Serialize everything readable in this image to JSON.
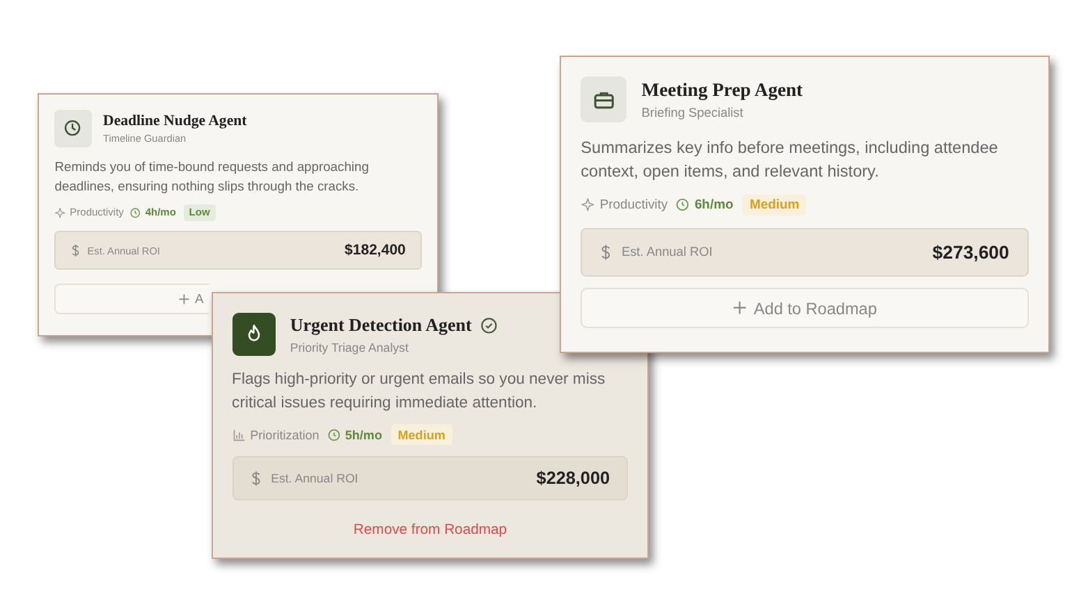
{
  "cards": [
    {
      "title": "Deadline Nudge Agent",
      "subtitle": "Timeline Guardian",
      "verified": false,
      "added": false,
      "description": "Reminds you of time-bound requests and approaching deadlines, ensuring nothing slips through the cracks.",
      "category": "Productivity",
      "time": "4h/mo",
      "tag": {
        "label": "Low",
        "color": "#5e8a3a"
      },
      "roi_label": "Est. Annual ROI",
      "roi_value": "$182,400",
      "action": "A"
    },
    {
      "title": "Urgent Detection Agent",
      "subtitle": "Priority Triage Analyst",
      "verified": true,
      "added": true,
      "description": "Flags high-priority or urgent emails so you never miss critical issues requiring immediate attention.",
      "category": "Prioritization",
      "time": "5h/mo",
      "tag": {
        "label": "Medium",
        "color": "#d9a21c"
      },
      "roi_label": "Est. Annual ROI",
      "roi_value": "$228,000",
      "action": "Remove from Roadmap"
    },
    {
      "title": "Meeting Prep Agent",
      "subtitle": "Briefing Specialist",
      "verified": false,
      "added": false,
      "description": "Summarizes key info before meetings, including attendee context, open items, and relevant history.",
      "category": "Productivity",
      "time": "6h/mo",
      "tag": {
        "label": "Medium",
        "color": "#d9a21c"
      },
      "roi_label": "Est. Annual ROI",
      "roi_value": "$273,600",
      "action": "Add to Roadmap"
    }
  ]
}
